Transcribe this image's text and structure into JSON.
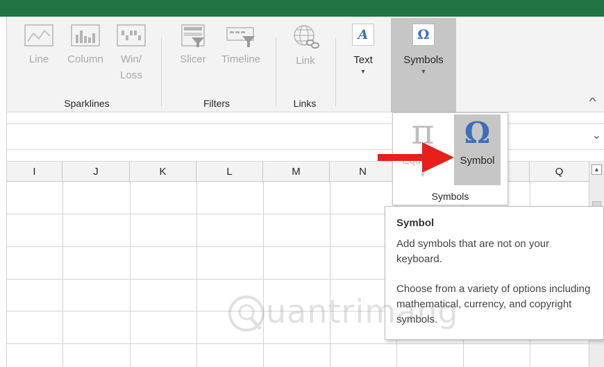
{
  "ribbon": {
    "sparklines": {
      "line_label": "Line",
      "column_label": "Column",
      "winloss_label_1": "Win/",
      "winloss_label_2": "Loss",
      "group_label": "Sparklines"
    },
    "filters": {
      "slicer_label": "Slicer",
      "timeline_label": "Timeline",
      "group_label": "Filters"
    },
    "links": {
      "link_label": "Link",
      "group_label": "Links"
    },
    "text_label": "Text",
    "symbols_label": "Symbols",
    "text_icon_glyph": "A",
    "symbols_icon_glyph": "Ω",
    "collapse_glyph": "^"
  },
  "formula_bar": {
    "expand_glyph": "⌄"
  },
  "columns": [
    "I",
    "J",
    "K",
    "L",
    "M",
    "N",
    "Q"
  ],
  "symbols_dropdown": {
    "equation_label": "Equation",
    "equation_glyph": "π",
    "symbol_label": "Symbol",
    "symbol_glyph": "Ω",
    "group_label": "Symbols"
  },
  "tooltip": {
    "title": "Symbol",
    "line1": "Add symbols that are not on your keyboard.",
    "line2": "Choose from a variety of options including mathematical, currency, and copyright symbols."
  },
  "watermark_text": "uantrimang",
  "colors": {
    "title_green": "#217346",
    "ribbon_bg": "#f3f3f3",
    "selected_bg": "#c6c6c6",
    "icon_blue": "#3b6fb6",
    "arrow_red": "#e8201a"
  }
}
